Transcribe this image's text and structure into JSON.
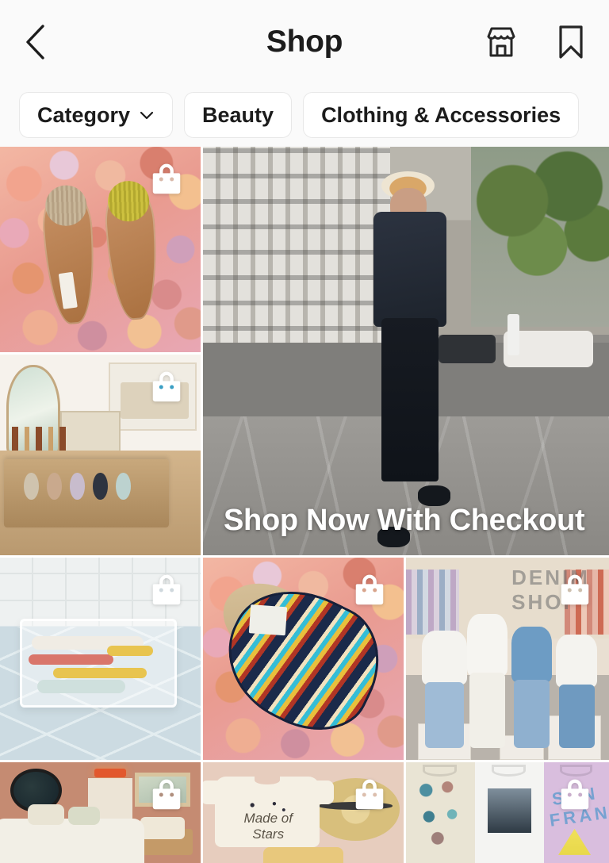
{
  "header": {
    "title": "Shop",
    "back_icon": "chevron-left-icon",
    "store_icon": "storefront-icon",
    "bookmark_icon": "bookmark-icon"
  },
  "filters": [
    {
      "label": "Category",
      "has_chevron": true,
      "icon": "chevron-down-icon"
    },
    {
      "label": "Beauty",
      "has_chevron": false
    },
    {
      "label": "Clothing & Accessories",
      "has_chevron": false
    }
  ],
  "grid": {
    "badge_icon": "shopping-bag-icon",
    "featured": {
      "overlay_text": "Shop Now With Checkout",
      "alt": "Woman in hat, dark denim shirt and black jeans standing on a city street"
    },
    "items": [
      {
        "alt": "Tan and yellow fringed slide sandals on coral seashells"
      },
      {
        "alt": "Wooden vanity drawer with folded clothes and organizers"
      },
      {
        "alt": "Clear cosmetic pouch with beauty products on blue tile"
      },
      {
        "alt": "Colorful woven slide sandal on coral seashells"
      },
      {
        "alt": "Denim Shop mannequin display with white and denim outfits",
        "sign_text": "DENIM SHOP"
      },
      {
        "alt": "Terracotta bedroom with round mirror, plants and patterned bedding"
      },
      {
        "alt": "Made of Stars cream tee with straw hat on pink background",
        "tee_text": "Made of Stars"
      },
      {
        "alt": "Graphic tees including a San Francisco print",
        "print_text": "SAN FRANCISCO"
      }
    ]
  },
  "colors": {
    "background": "#fafafa",
    "text": "#1c1c1c",
    "chip_border": "#e8e8e8",
    "overlay_text": "#ffffff"
  }
}
